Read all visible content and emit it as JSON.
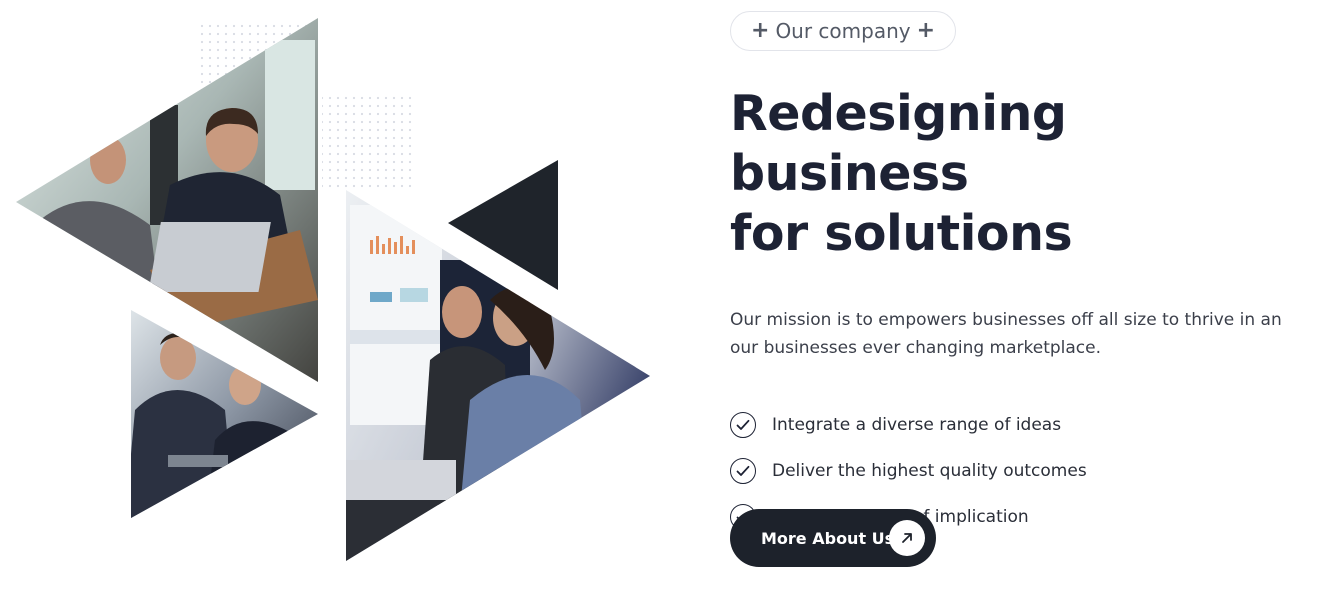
{
  "badge": {
    "label": "Our company",
    "icon": "plus-icon"
  },
  "heading": {
    "line1": "Redesigning business",
    "line2": "for solutions"
  },
  "description": "Our mission is to empowers businesses off all size to thrive in an our businesses ever changing marketplace.",
  "features": [
    {
      "label": "Integrate a diverse range of ideas",
      "icon": "check-circle-icon"
    },
    {
      "label": "Deliver the highest quality outcomes",
      "icon": "check-circle-icon"
    },
    {
      "label": "Believe in powerof implication",
      "icon": "check-circle-icon"
    }
  ],
  "cta": {
    "label": "More About Us",
    "icon": "arrow-up-right-icon"
  },
  "colors": {
    "primary_dark": "#1d222b",
    "heading": "#1d2234",
    "badge_border": "#e2e4ea",
    "accent_navy": "#2c3560"
  }
}
